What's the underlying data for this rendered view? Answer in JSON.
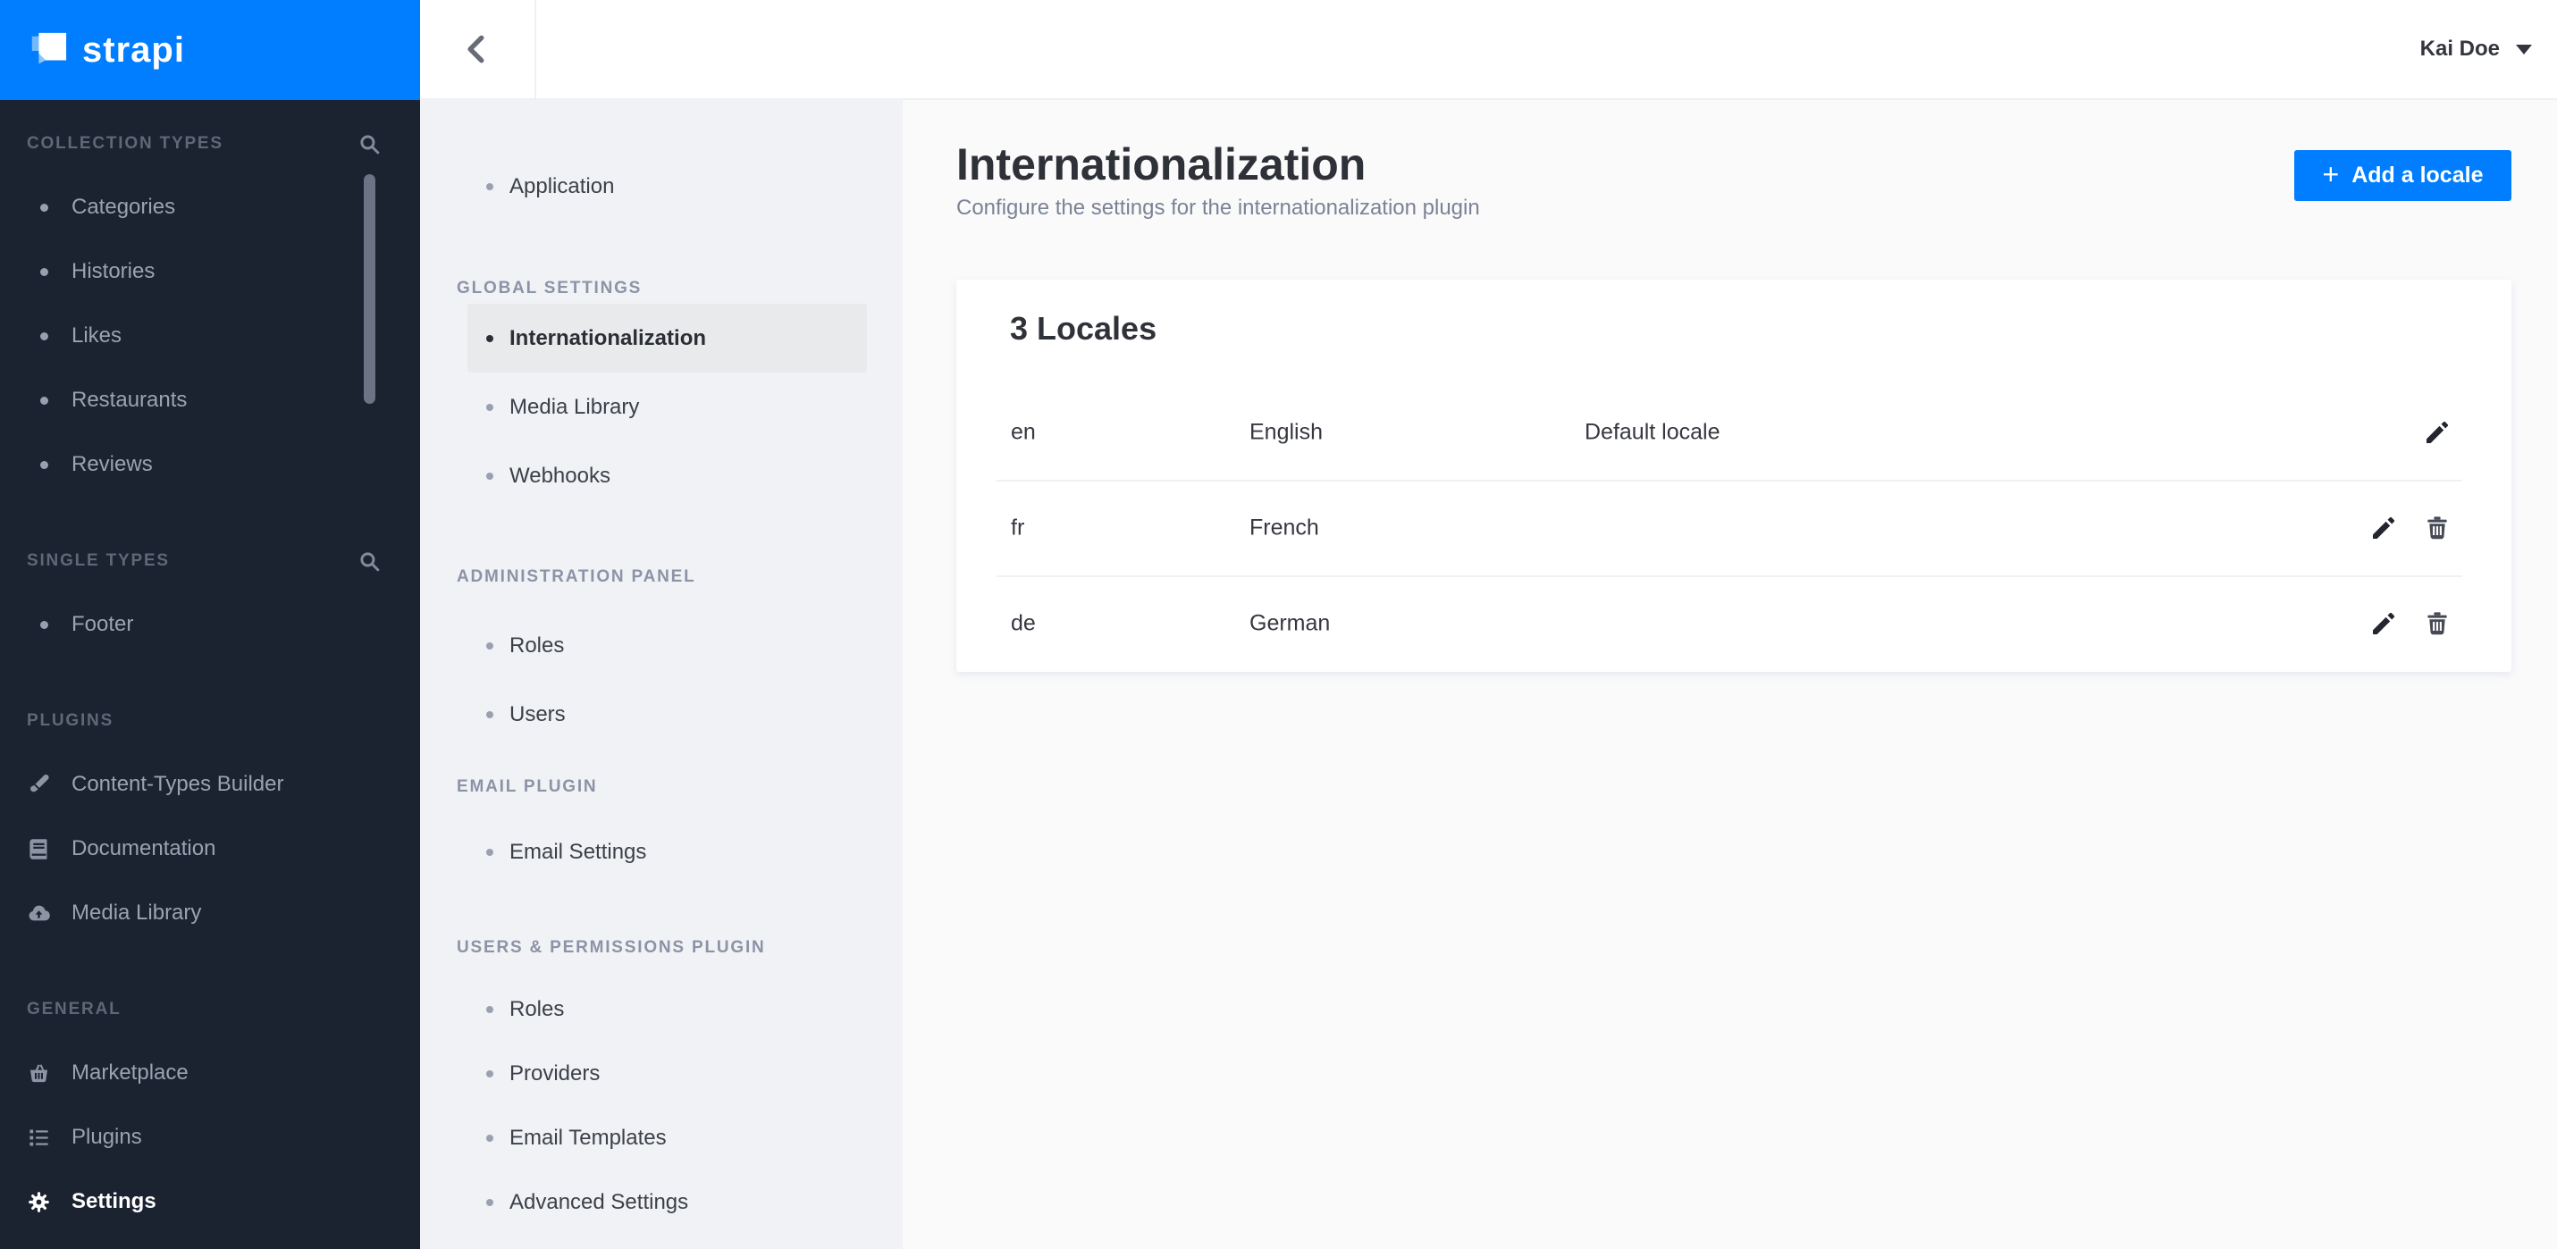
{
  "brand": {
    "name": "strapi"
  },
  "topbar": {
    "user_name": "Kai Doe"
  },
  "main_nav": {
    "sections": [
      {
        "label": "COLLECTION TYPES",
        "has_search": true,
        "items": [
          {
            "label": "Categories"
          },
          {
            "label": "Histories"
          },
          {
            "label": "Likes"
          },
          {
            "label": "Restaurants"
          },
          {
            "label": "Reviews"
          }
        ]
      },
      {
        "label": "SINGLE TYPES",
        "has_search": true,
        "items": [
          {
            "label": "Footer"
          }
        ]
      },
      {
        "label": "PLUGINS",
        "items": [
          {
            "label": "Content-Types Builder",
            "icon": "paintbrush-icon"
          },
          {
            "label": "Documentation",
            "icon": "book-icon"
          },
          {
            "label": "Media Library",
            "icon": "cloud-upload-icon"
          }
        ]
      },
      {
        "label": "GENERAL",
        "items": [
          {
            "label": "Marketplace",
            "icon": "basket-icon"
          },
          {
            "label": "Plugins",
            "icon": "list-icon"
          },
          {
            "label": "Settings",
            "icon": "gear-icon",
            "active": true
          }
        ]
      }
    ]
  },
  "settings_nav": {
    "application": {
      "label": "Application"
    },
    "sections": [
      {
        "label": "GLOBAL SETTINGS",
        "items": [
          {
            "label": "Internationalization",
            "active": true
          },
          {
            "label": "Media Library"
          },
          {
            "label": "Webhooks"
          }
        ]
      },
      {
        "label": "ADMINISTRATION PANEL",
        "items": [
          {
            "label": "Roles"
          },
          {
            "label": "Users"
          }
        ]
      },
      {
        "label": "EMAIL PLUGIN",
        "items": [
          {
            "label": "Email Settings"
          }
        ]
      },
      {
        "label": "USERS & PERMISSIONS PLUGIN",
        "items": [
          {
            "label": "Roles"
          },
          {
            "label": "Providers"
          },
          {
            "label": "Email Templates"
          },
          {
            "label": "Advanced Settings"
          }
        ]
      }
    ]
  },
  "page": {
    "title": "Internationalization",
    "subtitle": "Configure the settings for the internationalization plugin",
    "add_button_label": "Add a locale",
    "add_button_plus": "+"
  },
  "locales_card": {
    "title": "3 Locales",
    "rows": [
      {
        "code": "en",
        "name": "English",
        "note": "Default locale",
        "deletable": false
      },
      {
        "code": "fr",
        "name": "French",
        "note": "",
        "deletable": true
      },
      {
        "code": "de",
        "name": "German",
        "note": "",
        "deletable": true
      }
    ]
  },
  "colors": {
    "accent_blue": "#007eff",
    "sidebar_dark": "#1b2230",
    "settings_sidebar_bg": "#f1f2f5",
    "main_bg": "#fafafb",
    "active_item_bg": "#e9eaec"
  }
}
